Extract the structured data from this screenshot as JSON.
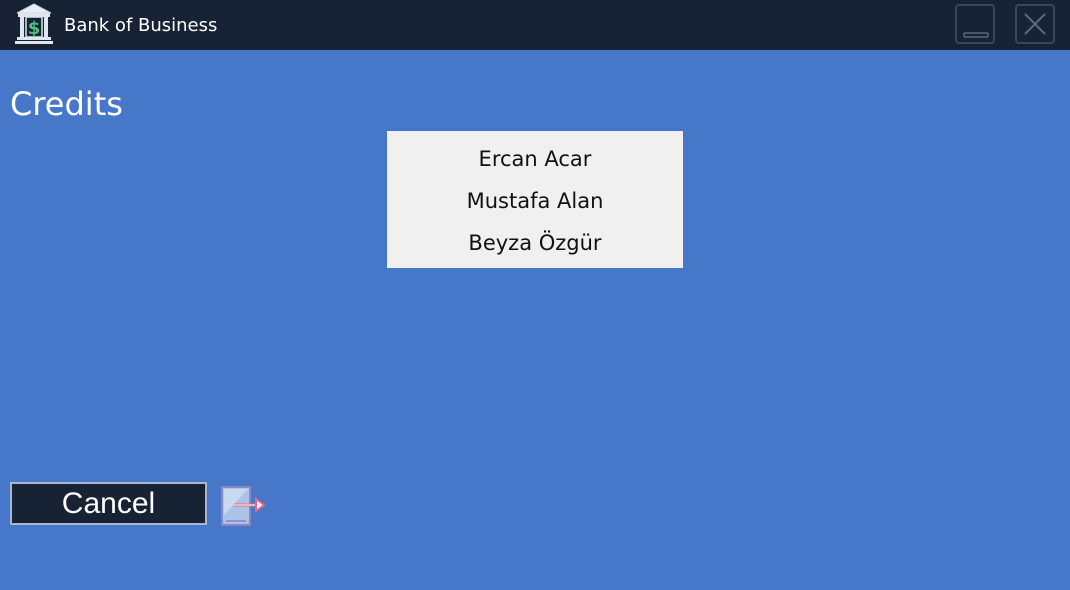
{
  "window": {
    "title": "Bank of Business",
    "app_icon": "bank-dollar-icon",
    "minimize_icon": "minimize-icon",
    "close_icon": "close-icon"
  },
  "page": {
    "title": "Credits"
  },
  "credits": {
    "names": [
      "Ercan Acar",
      "Mustafa Alan",
      "Beyza Özgür"
    ]
  },
  "actions": {
    "cancel_label": "Cancel",
    "exit_icon": "exit-arrow-icon"
  },
  "colors": {
    "background": "#4677c8",
    "titlebar": "#172234",
    "credits_panel": "#f0f0f0",
    "icon_accent": "#4cc27a"
  }
}
